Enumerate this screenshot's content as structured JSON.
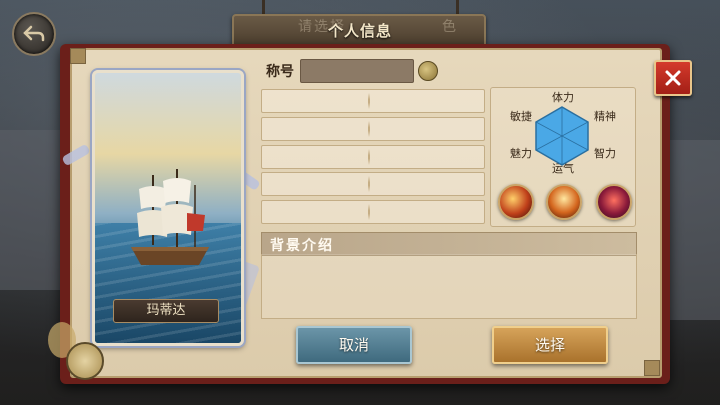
{
  "header": {
    "ghost_text": "请选择",
    "ghost_text_right": "色",
    "title": "个人信息"
  },
  "character": {
    "name": "玛蒂达"
  },
  "form": {
    "title_label": "称号",
    "title_value": "",
    "info_rows": [
      "",
      "",
      "",
      "",
      ""
    ]
  },
  "stats": {
    "labels": {
      "stamina": "体力",
      "agility": "敏捷",
      "spirit": "精神",
      "charm": "魅力",
      "intellect": "智力",
      "luck": "运气"
    }
  },
  "skills": [
    "fire-orb-skill-icon",
    "flame-sword-skill-icon",
    "demon-skill-icon"
  ],
  "background": {
    "header": "背景介绍",
    "content": ""
  },
  "buttons": {
    "cancel": "取消",
    "select": "选择"
  },
  "colors": {
    "frame": "#6b1f1a",
    "paper": "#e6d8bc",
    "close": "#d43a2c",
    "cancel": "#4f7e92",
    "select": "#c08a40",
    "stat_hex": "#4aa8e6"
  }
}
